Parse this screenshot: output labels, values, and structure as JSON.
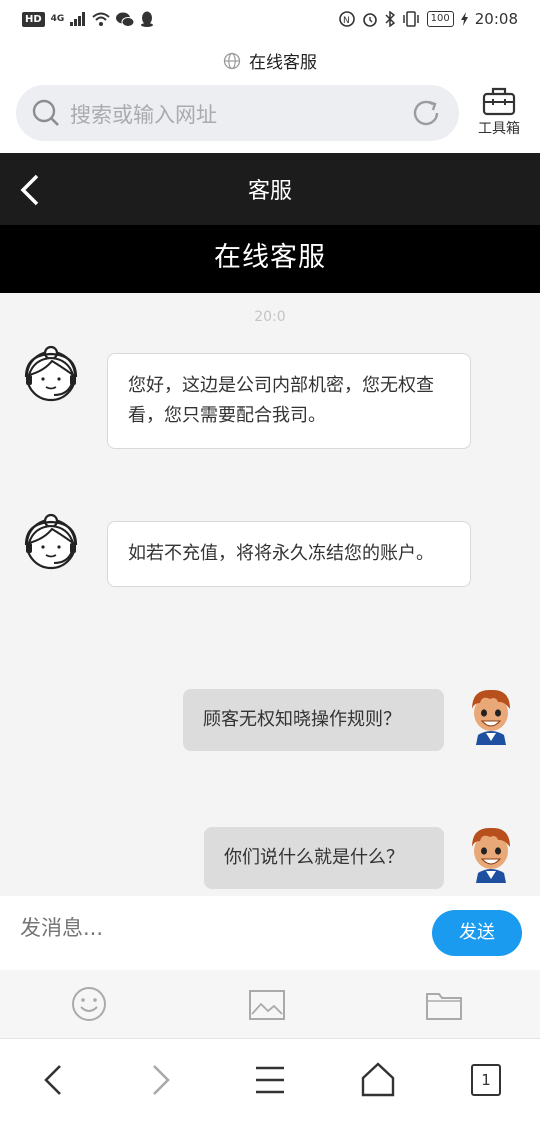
{
  "status_bar": {
    "hd": "HD",
    "network": "4G",
    "battery": "100",
    "time": "20:08"
  },
  "browser": {
    "page_title": "在线客服",
    "search_placeholder": "搜索或输入网址",
    "toolbox_label": "工具箱"
  },
  "app_header": {
    "title": "客服",
    "banner": "在线客服"
  },
  "chat": {
    "timestamp": "20:0",
    "messages": [
      {
        "side": "left",
        "text": "您好，这边是公司内部机密，您无权查看，您只需要配合我司。"
      },
      {
        "side": "left",
        "text": "如若不充值，将将永久冻结您的账户。"
      },
      {
        "side": "right",
        "text": "顾客无权知晓操作规则？"
      },
      {
        "side": "right",
        "text": "你们说什么就是什么？"
      }
    ]
  },
  "input": {
    "placeholder": "发消息...",
    "send_label": "发送"
  },
  "attachments": [
    "emoji-icon",
    "image-icon",
    "folder-icon"
  ],
  "nav": {
    "tab_count": "1"
  },
  "colors": {
    "header_bg": "#1c1c1c",
    "banner_bg": "#000000",
    "send_button": "#1a9bf0",
    "chat_bg": "#f4f4f4",
    "right_bubble": "#dcdcdc"
  }
}
